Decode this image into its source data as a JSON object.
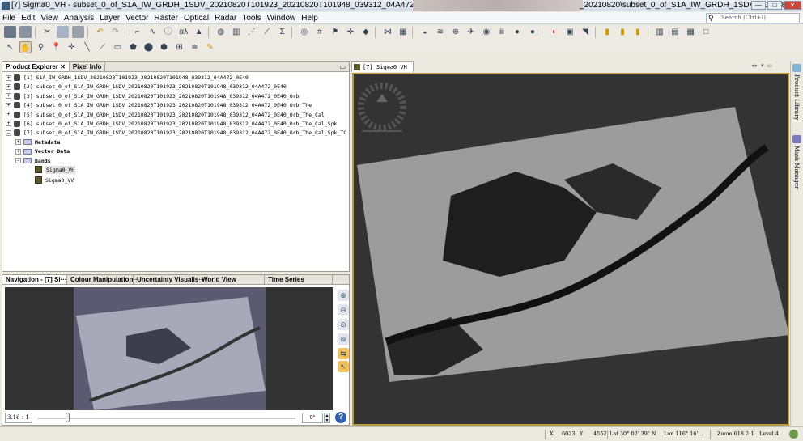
{
  "window": {
    "title": "[7] Sigma0_VH - subset_0_of_S1A_IW_GRDH_1SDV_20210820T101923_20210820T101948_039312_04A472_0E40_Orb_The_Cal_Spk_TC",
    "title_path": "_20210820\\subset_0_of_S1A_IW_GRDH_1SDV_202108...",
    "minimize": "—",
    "maximize": "□",
    "close": "✕"
  },
  "menu": [
    "File",
    "Edit",
    "View",
    "Analysis",
    "Layer",
    "Vector",
    "Raster",
    "Optical",
    "Radar",
    "Tools",
    "Window",
    "Help"
  ],
  "search": {
    "placeholder": "Search (Ctrl+I)"
  },
  "left_tabs": {
    "product_explorer": "Product Explorer",
    "pixel_info": "Pixel Info"
  },
  "products": [
    {
      "label": "[1] S1A_IW_GRDH_1SDV_20210820T101923_20210820T101948_039312_04A472_0E40"
    },
    {
      "label": "[2] subset_0_of_S1A_IW_GRDH_1SDV_20210820T101923_20210820T101948_039312_04A472_0E40"
    },
    {
      "label": "[3] subset_0_of_S1A_IW_GRDH_1SDV_20210820T101923_20210820T101948_039312_04A472_0E40_Orb"
    },
    {
      "label": "[4] subset_0_of_S1A_IW_GRDH_1SDV_20210820T101923_20210820T101948_039312_04A472_0E40_Orb_The"
    },
    {
      "label": "[5] subset_0_of_S1A_IW_GRDH_1SDV_20210820T101923_20210820T101948_039312_04A472_0E40_Orb_The_Cal"
    },
    {
      "label": "[6] subset_0_of_S1A_IW_GRDH_1SDV_20210820T101923_20210820T101948_039312_04A472_0E40_Orb_The_Cal_Spk"
    },
    {
      "label": "[7] subset_0_of_S1A_IW_GRDH_1SDV_20210820T101923_20210820T101948_039312_04A472_0E40_Orb_The_Cal_Spk_TC"
    }
  ],
  "product7_children": {
    "metadata": "Metadata",
    "vector_data": "Vector Data",
    "bands": "Bands",
    "band_items": [
      "Sigma0_VH",
      "Sigma0_VV"
    ]
  },
  "bottom_tabs": [
    "Navigation - [7] Si···",
    "Colour Manipulation···",
    "Uncertainty Visualis···",
    "World View",
    "Time Series"
  ],
  "navigation": {
    "scale": "3.16 : 1",
    "rotation": "0°",
    "zoom_slider": 0.18
  },
  "image_tab": "[7] Sigma0_VH",
  "right_sidebar": {
    "product_library": "Product Library",
    "mask_manager": "Mask Manager"
  },
  "status": {
    "x_label": "X",
    "x": "6023",
    "y_label": "Y",
    "y": "4552",
    "lat": "Lat 30° 02' 39\" N",
    "lon": "Lon 116° 16'...",
    "zoom": "Zoom 618.2:1",
    "level": "Level 4"
  }
}
